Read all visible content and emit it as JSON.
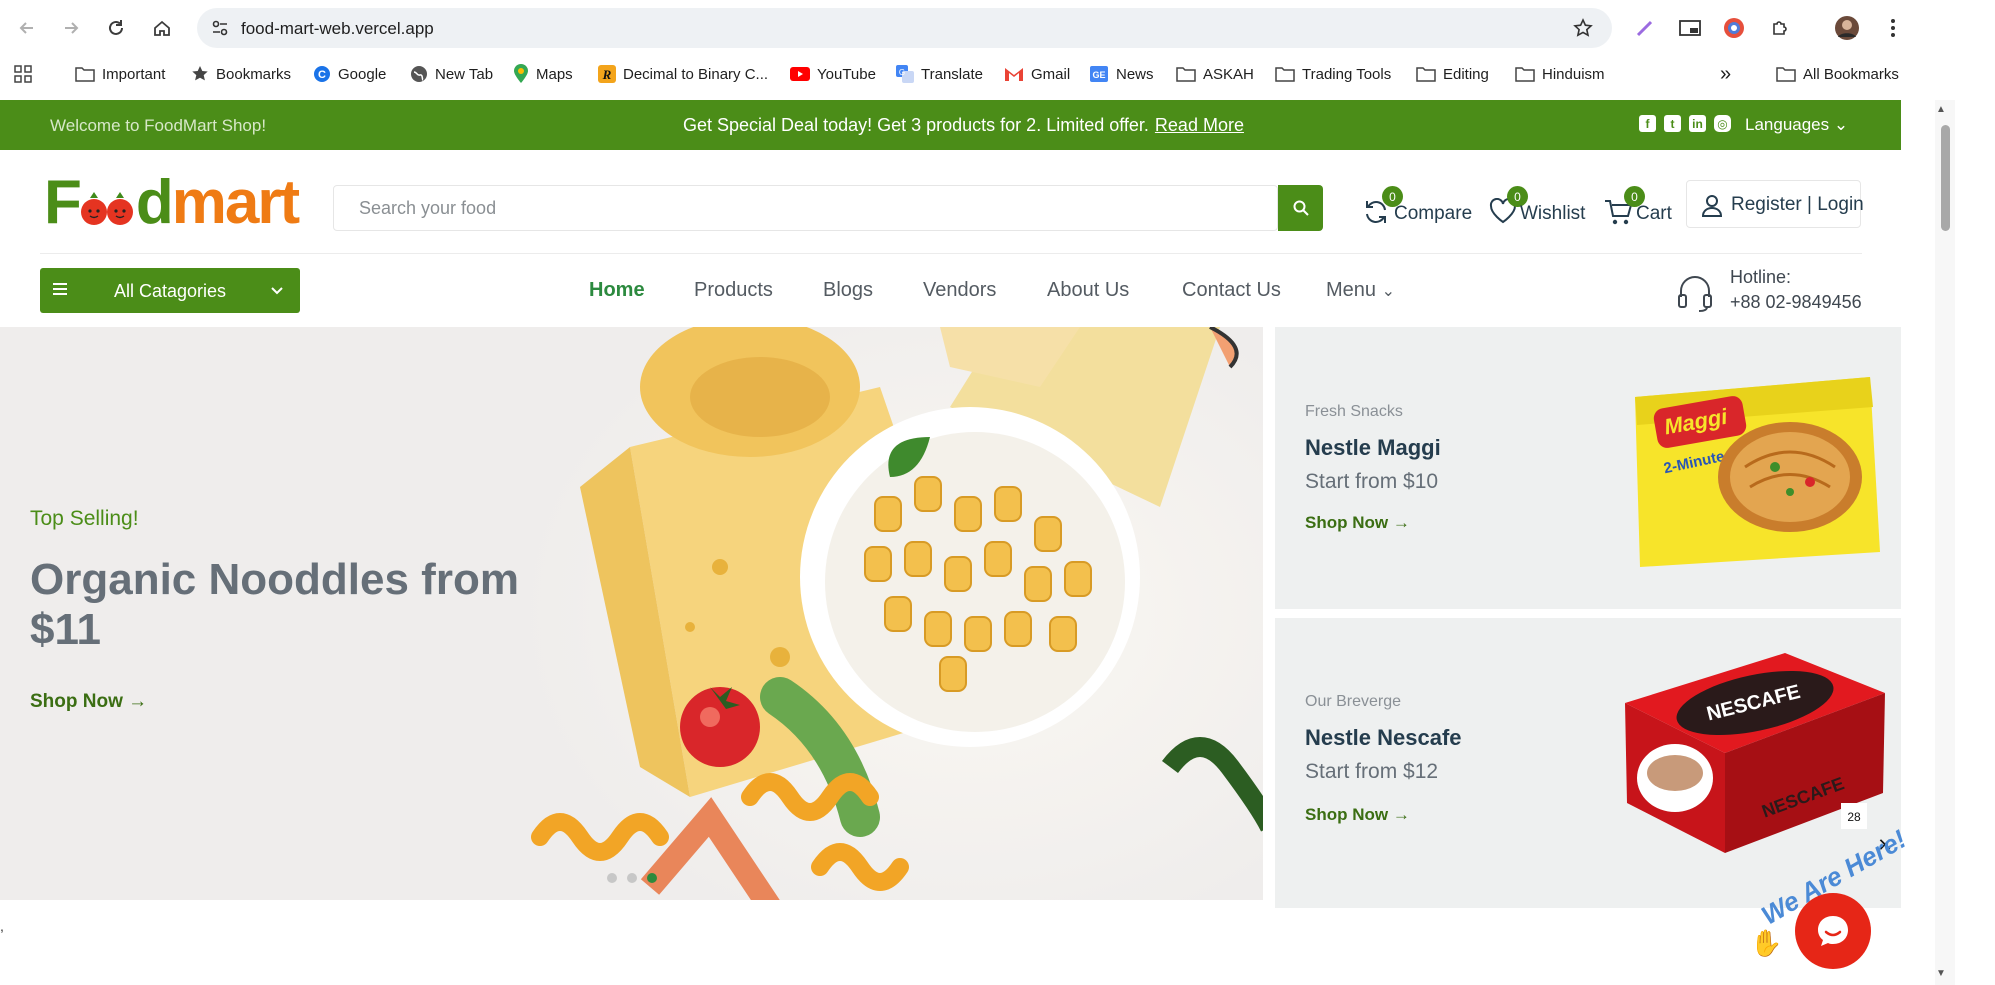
{
  "browser": {
    "url": "food-mart-web.vercel.app",
    "bookmarks": [
      {
        "label": "Important",
        "icon": "folder-icon"
      },
      {
        "label": "Bookmarks",
        "icon": "star-icon"
      },
      {
        "label": "Google",
        "icon": "google-icon"
      },
      {
        "label": "New Tab",
        "icon": "globe-icon"
      },
      {
        "label": "Maps",
        "icon": "maps-icon"
      },
      {
        "label": "Decimal to Binary C...",
        "icon": "r-icon"
      },
      {
        "label": "YouTube",
        "icon": "youtube-icon"
      },
      {
        "label": "Translate",
        "icon": "translate-icon"
      },
      {
        "label": "Gmail",
        "icon": "gmail-icon"
      },
      {
        "label": "News",
        "icon": "news-icon"
      },
      {
        "label": "ASKAH",
        "icon": "folder-icon"
      },
      {
        "label": "Trading Tools",
        "icon": "folder-icon"
      },
      {
        "label": "Editing",
        "icon": "folder-icon"
      },
      {
        "label": "Hinduism",
        "icon": "folder-icon"
      }
    ],
    "more_label": "»",
    "all_bookmarks": "All Bookmarks"
  },
  "topbar": {
    "welcome": "Welcome to FoodMart Shop!",
    "deal": "Get Special Deal today! Get 3 products for 2. Limited offer.",
    "read_more": "Read More",
    "languages": "Languages"
  },
  "header": {
    "logo_prefix": "F",
    "logo_mid": "d",
    "logo_suffix": "mart",
    "search_placeholder": "Search your food",
    "compare_label": "Compare",
    "compare_count": "0",
    "wishlist_label": "Wishlist",
    "wishlist_count": "0",
    "cart_label": "Cart",
    "cart_count": "0",
    "account_label": "Register | Login"
  },
  "nav": {
    "all_categories": "All Catagories",
    "links": [
      "Home",
      "Products",
      "Blogs",
      "Vendors",
      "About Us",
      "Contact Us",
      "Menu"
    ],
    "hotline_label": "Hotline:",
    "hotline_number": "+88 02-9849456"
  },
  "hero": {
    "tag": "Top Selling!",
    "title": "Organic Nooddles from $11",
    "shop_now": "Shop Now →",
    "active_slide": 3,
    "slide_count": 3
  },
  "promos": [
    {
      "category": "Fresh Snacks",
      "name": "Nestle Maggi",
      "price": "Start from $10",
      "shop_now": "Shop Now →"
    },
    {
      "category": "Our Breverge",
      "name": "Nestle Nescafe",
      "price": "Start from $12",
      "shop_now": "Shop Now →"
    }
  ],
  "chat": {
    "banner": "We Are Here!",
    "close": "✕"
  },
  "colors": {
    "brand_green": "#4b8d18",
    "brand_orange": "#ef7b14",
    "chat_red": "#e62617"
  }
}
